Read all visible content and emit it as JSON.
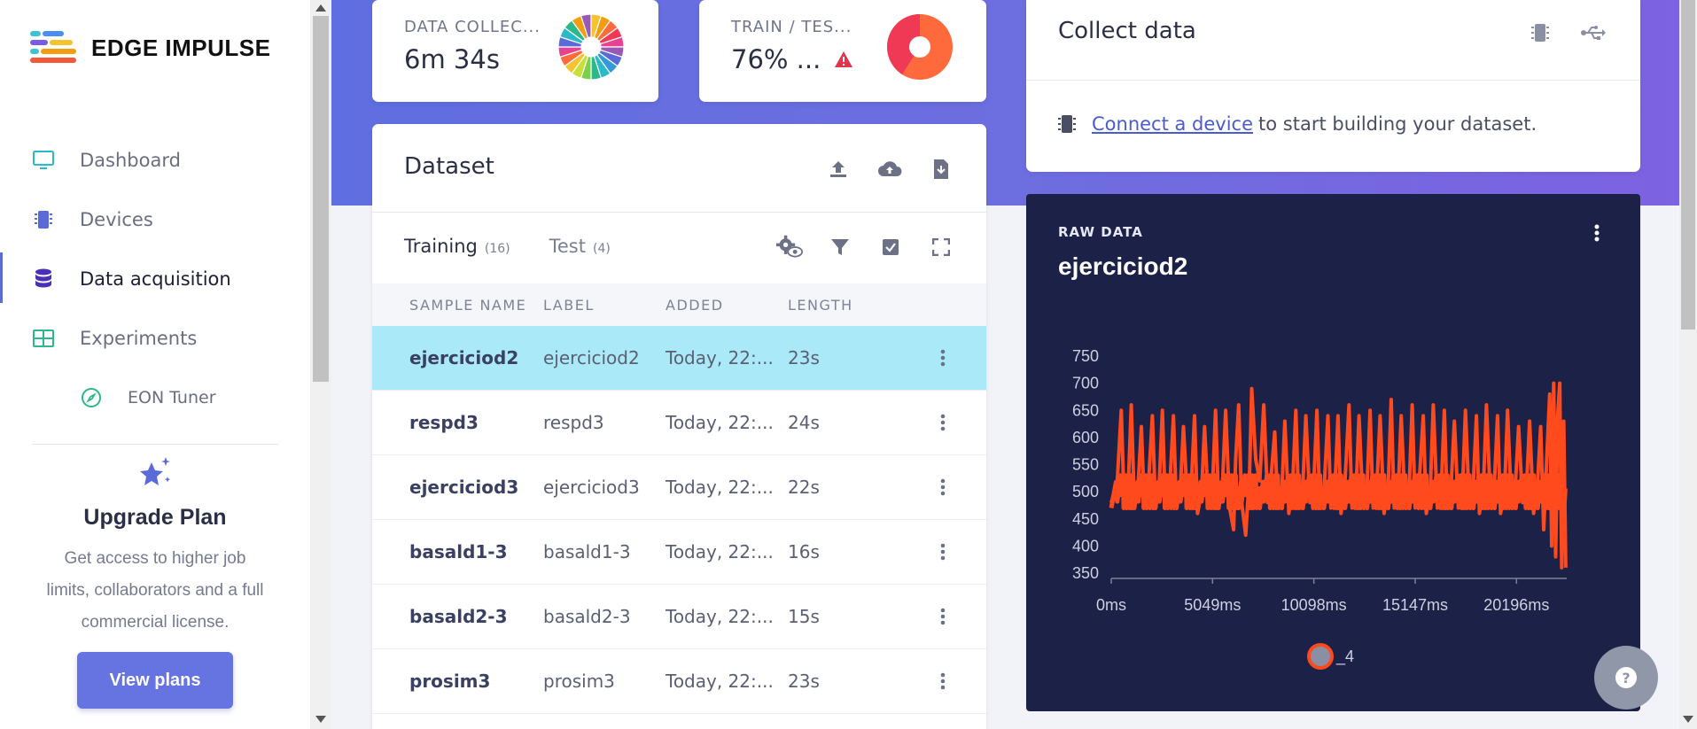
{
  "app": {
    "brand": "EDGE IMPULSE"
  },
  "sidebar": {
    "items": [
      {
        "label": "Dashboard"
      },
      {
        "label": "Devices"
      },
      {
        "label": "Data acquisition"
      },
      {
        "label": "Experiments"
      },
      {
        "label": "EON Tuner"
      }
    ],
    "upgrade": {
      "title": "Upgrade Plan",
      "text_lines": [
        "Get access to higher job",
        "limits, collaborators and a full",
        "commercial license."
      ],
      "button": "View plans"
    }
  },
  "stats": {
    "data_collected": {
      "label": "DATA COLLEC...",
      "value": "6m 34s"
    },
    "train_test": {
      "label": "TRAIN / TES...",
      "value": "76% ..."
    }
  },
  "dataset": {
    "title": "Dataset",
    "tabs": [
      {
        "label": "Training",
        "count": "(16)"
      },
      {
        "label": "Test",
        "count": "(4)"
      }
    ],
    "columns": [
      "SAMPLE NAME",
      "LABEL",
      "ADDED",
      "LENGTH"
    ],
    "rows": [
      {
        "name": "ejerciciod2",
        "label": "ejerciciod2",
        "added": "Today, 22:...",
        "length": "23s"
      },
      {
        "name": "respd3",
        "label": "respd3",
        "added": "Today, 22:...",
        "length": "24s"
      },
      {
        "name": "ejerciciod3",
        "label": "ejerciciod3",
        "added": "Today, 22:...",
        "length": "22s"
      },
      {
        "name": "basald1-3",
        "label": "basald1-3",
        "added": "Today, 22:...",
        "length": "16s"
      },
      {
        "name": "basald2-3",
        "label": "basald2-3",
        "added": "Today, 22:...",
        "length": "15s"
      },
      {
        "name": "prosim3",
        "label": "prosim3",
        "added": "Today, 22:...",
        "length": "23s"
      }
    ]
  },
  "collect": {
    "title": "Collect data",
    "link": "Connect a device",
    "message": "to start building your dataset."
  },
  "raw": {
    "label": "RAW DATA",
    "title": "ejerciciod2",
    "legend": "_4"
  },
  "colors": {
    "accent": "#6674e1",
    "series": "#ff4a1e",
    "selected_row": "#aae9f7",
    "raw_bg": "#1c2148"
  },
  "chart_data": {
    "type": "line",
    "y_ticks": [
      "750",
      "700",
      "650",
      "600",
      "550",
      "500",
      "450",
      "400",
      "350"
    ],
    "x_ticks": [
      "0ms",
      "5049ms",
      "10098ms",
      "15147ms",
      "20196ms"
    ],
    "ylim": [
      350,
      750
    ],
    "xlim": [
      0,
      22700
    ],
    "series": [
      {
        "name": "_4",
        "color": "#ff4a1e"
      }
    ],
    "points": [
      [
        0,
        480
      ],
      [
        300,
        520
      ],
      [
        500,
        650
      ],
      [
        650,
        470
      ],
      [
        850,
        510
      ],
      [
        1000,
        660
      ],
      [
        1150,
        480
      ],
      [
        1350,
        520
      ],
      [
        1500,
        620
      ],
      [
        1650,
        470
      ],
      [
        1850,
        510
      ],
      [
        2050,
        640
      ],
      [
        2200,
        480
      ],
      [
        2400,
        520
      ],
      [
        2550,
        650
      ],
      [
        2700,
        470
      ],
      [
        2900,
        500
      ],
      [
        3100,
        640
      ],
      [
        3250,
        470
      ],
      [
        3450,
        510
      ],
      [
        3600,
        620
      ],
      [
        3800,
        480
      ],
      [
        4000,
        520
      ],
      [
        4150,
        640
      ],
      [
        4300,
        460
      ],
      [
        4500,
        500
      ],
      [
        4650,
        620
      ],
      [
        4850,
        470
      ],
      [
        5050,
        510
      ],
      [
        5200,
        650
      ],
      [
        5350,
        480
      ],
      [
        5550,
        520
      ],
      [
        5700,
        650
      ],
      [
        5900,
        470
      ],
      [
        6100,
        430
      ],
      [
        6200,
        560
      ],
      [
        6350,
        660
      ],
      [
        6500,
        480
      ],
      [
        6700,
        420
      ],
      [
        6900,
        540
      ],
      [
        7000,
        690
      ],
      [
        7200,
        560
      ],
      [
        7400,
        520
      ],
      [
        7600,
        660
      ],
      [
        7800,
        480
      ],
      [
        7950,
        520
      ],
      [
        8150,
        610
      ],
      [
        8300,
        470
      ],
      [
        8500,
        500
      ],
      [
        8650,
        630
      ],
      [
        8850,
        460
      ],
      [
        9050,
        520
      ],
      [
        9200,
        650
      ],
      [
        9350,
        470
      ],
      [
        9550,
        510
      ],
      [
        9700,
        640
      ],
      [
        9900,
        480
      ],
      [
        10100,
        520
      ],
      [
        10250,
        650
      ],
      [
        10400,
        470
      ],
      [
        10600,
        500
      ],
      [
        10800,
        640
      ],
      [
        10950,
        470
      ],
      [
        11150,
        510
      ],
      [
        11300,
        640
      ],
      [
        11450,
        460
      ],
      [
        11650,
        520
      ],
      [
        11850,
        660
      ],
      [
        12000,
        470
      ],
      [
        12200,
        500
      ],
      [
        12350,
        640
      ],
      [
        12550,
        470
      ],
      [
        12750,
        510
      ],
      [
        12900,
        650
      ],
      [
        13050,
        470
      ],
      [
        13250,
        520
      ],
      [
        13400,
        640
      ],
      [
        13600,
        460
      ],
      [
        13800,
        510
      ],
      [
        13950,
        670
      ],
      [
        14100,
        470
      ],
      [
        14300,
        500
      ],
      [
        14450,
        640
      ],
      [
        14650,
        470
      ],
      [
        14850,
        510
      ],
      [
        15000,
        660
      ],
      [
        15150,
        470
      ],
      [
        15350,
        520
      ],
      [
        15550,
        640
      ],
      [
        15700,
        460
      ],
      [
        15900,
        500
      ],
      [
        16050,
        660
      ],
      [
        16250,
        470
      ],
      [
        16450,
        510
      ],
      [
        16600,
        650
      ],
      [
        16750,
        470
      ],
      [
        16950,
        520
      ],
      [
        17100,
        630
      ],
      [
        17300,
        470
      ],
      [
        17500,
        500
      ],
      [
        17650,
        650
      ],
      [
        17850,
        470
      ],
      [
        18050,
        520
      ],
      [
        18200,
        640
      ],
      [
        18350,
        460
      ],
      [
        18550,
        510
      ],
      [
        18700,
        660
      ],
      [
        18900,
        480
      ],
      [
        19100,
        520
      ],
      [
        19250,
        640
      ],
      [
        19400,
        460
      ],
      [
        19600,
        500
      ],
      [
        19750,
        650
      ],
      [
        19950,
        470
      ],
      [
        20150,
        520
      ],
      [
        20300,
        620
      ],
      [
        20500,
        480
      ],
      [
        20700,
        510
      ],
      [
        20850,
        630
      ],
      [
        21050,
        460
      ],
      [
        21250,
        520
      ],
      [
        21400,
        620
      ],
      [
        21550,
        430
      ],
      [
        21700,
        560
      ],
      [
        21850,
        680
      ],
      [
        21950,
        400
      ],
      [
        22050,
        700
      ],
      [
        22150,
        380
      ],
      [
        22250,
        640
      ],
      [
        22350,
        700
      ],
      [
        22450,
        360
      ],
      [
        22550,
        630
      ],
      [
        22650,
        360
      ]
    ]
  }
}
